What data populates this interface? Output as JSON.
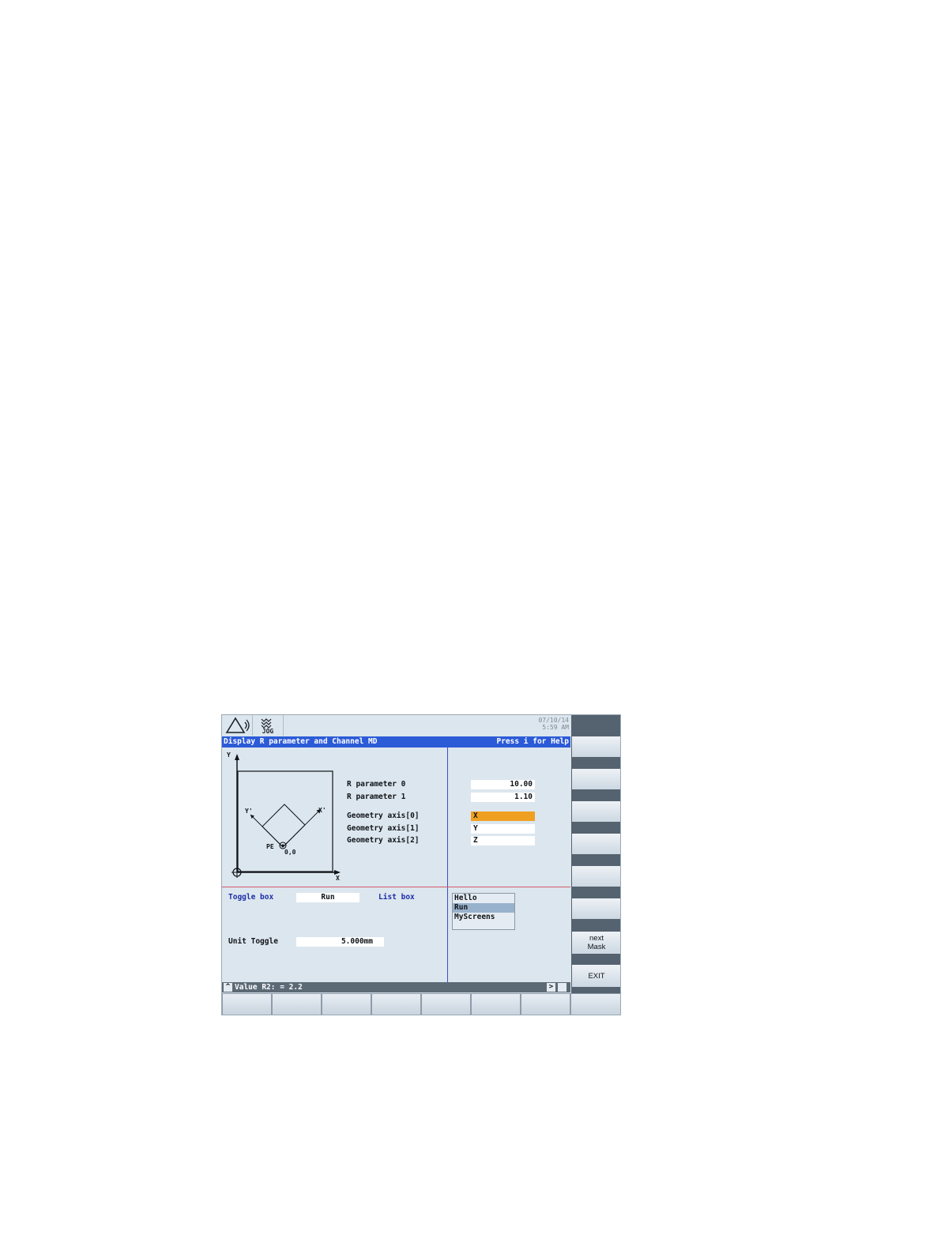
{
  "header": {
    "mode_label": "JOG",
    "date": "07/10/14",
    "time": "5:59 AM"
  },
  "titlebar": {
    "title": "Display R parameter and Channel MD",
    "help": "Press i for Help"
  },
  "diagram": {
    "y_axis": "Y",
    "x_axis": "X",
    "y_prime": "Y'",
    "x_prime": "X'",
    "pe_label": "PE",
    "origin_label": "0,0"
  },
  "params": {
    "r0_label": "R parameter 0",
    "r0_value": "10.00",
    "r1_label": "R parameter 1",
    "r1_value": "1.10",
    "geo0_label": "Geometry axis[0]",
    "geo0_value": "X",
    "geo1_label": "Geometry axis[1]",
    "geo1_value": "Y",
    "geo2_label": "Geometry axis[2]",
    "geo2_value": "Z"
  },
  "controls": {
    "toggle_label": "Toggle box",
    "toggle_value": "Run",
    "list_label": "List box",
    "list_items": [
      "Hello",
      "Run",
      "MyScreens"
    ],
    "list_selected": "Run",
    "unit_label": "Unit Toggle",
    "unit_value": "5.000mm"
  },
  "status": {
    "up_arrow": "^",
    "message": "Value R2: = 2.2",
    "next_arrow": ">"
  },
  "softkeys": {
    "next_mask": "next\nMask",
    "exit": "EXIT"
  },
  "colors": {
    "title_bar": "#2c5bd8",
    "highlight": "#f0a020",
    "selection": "#98b2cc",
    "label_blue": "#1d2ea8"
  }
}
